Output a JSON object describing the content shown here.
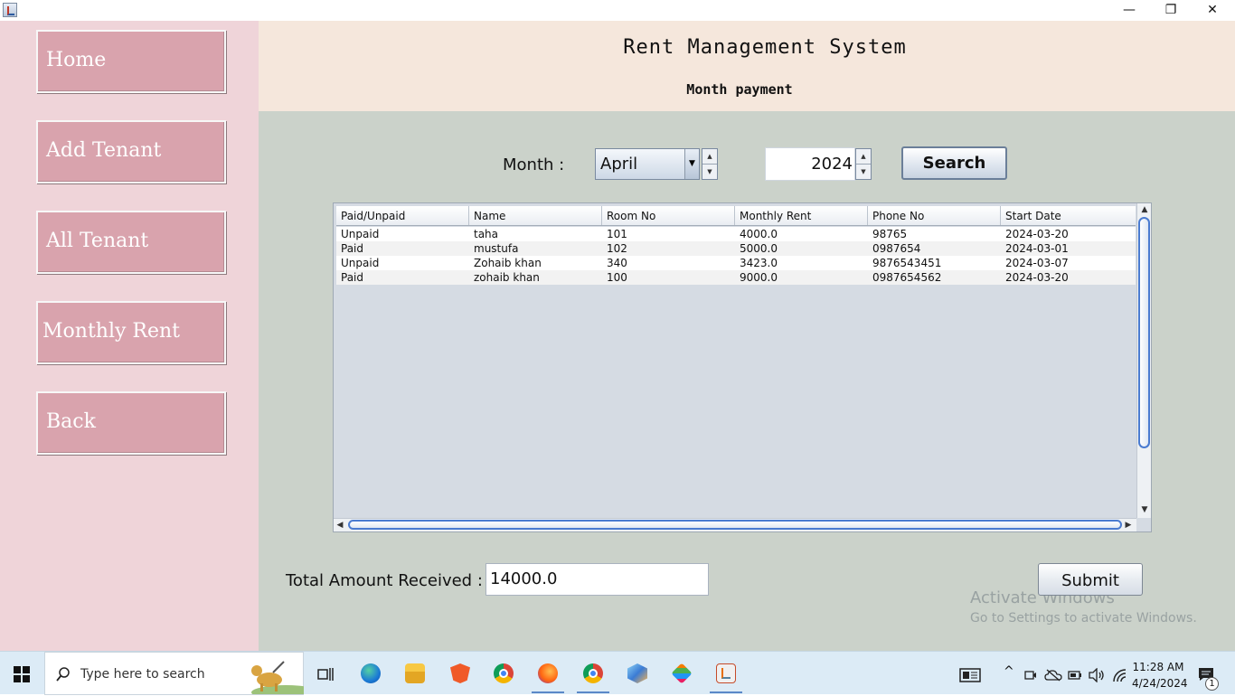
{
  "window": {
    "minimize_glyph": "—",
    "restore_glyph": "❐",
    "close_glyph": "✕"
  },
  "sidebar": {
    "items": [
      {
        "label": "Home"
      },
      {
        "label": "Add Tenant"
      },
      {
        "label": "All Tenant"
      },
      {
        "label": "Monthly Rent"
      },
      {
        "label": "Back"
      }
    ]
  },
  "header": {
    "title": "Rent Management System",
    "subtitle": "Month payment"
  },
  "filters": {
    "month_label": "Month :",
    "month_selected": "April",
    "year_value": "2024",
    "search_label": "Search"
  },
  "table": {
    "columns": [
      "Paid/Unpaid",
      "Name",
      "Room No",
      "Monthly Rent",
      "Phone No",
      "Start Date"
    ],
    "rows": [
      [
        "Unpaid",
        "taha",
        "101",
        "4000.0",
        "98765",
        "2024-03-20"
      ],
      [
        "Paid",
        "mustufa",
        "102",
        "5000.0",
        "0987654",
        "2024-03-01"
      ],
      [
        "Unpaid",
        "Zohaib khan",
        "340",
        "3423.0",
        "9876543451",
        "2024-03-07"
      ],
      [
        "Paid",
        "zohaib khan",
        "100",
        "9000.0",
        "0987654562",
        "2024-03-20"
      ]
    ]
  },
  "footer": {
    "total_label": "Total Amount Received :",
    "total_value": "14000.0",
    "submit_label": "Submit"
  },
  "watermark": {
    "line1": "Activate Windows",
    "line2": "Go to Settings to activate Windows."
  },
  "taskbar": {
    "search_placeholder": "Type here to search",
    "time": "11:28 AM",
    "date": "4/24/2024",
    "notification_count": "1"
  },
  "colors": {
    "sidebar_bg": "#efd4d9",
    "nav_button": "#d9a3ad",
    "header_bg": "#f5e7dc",
    "content_bg": "#cbd2ca"
  }
}
